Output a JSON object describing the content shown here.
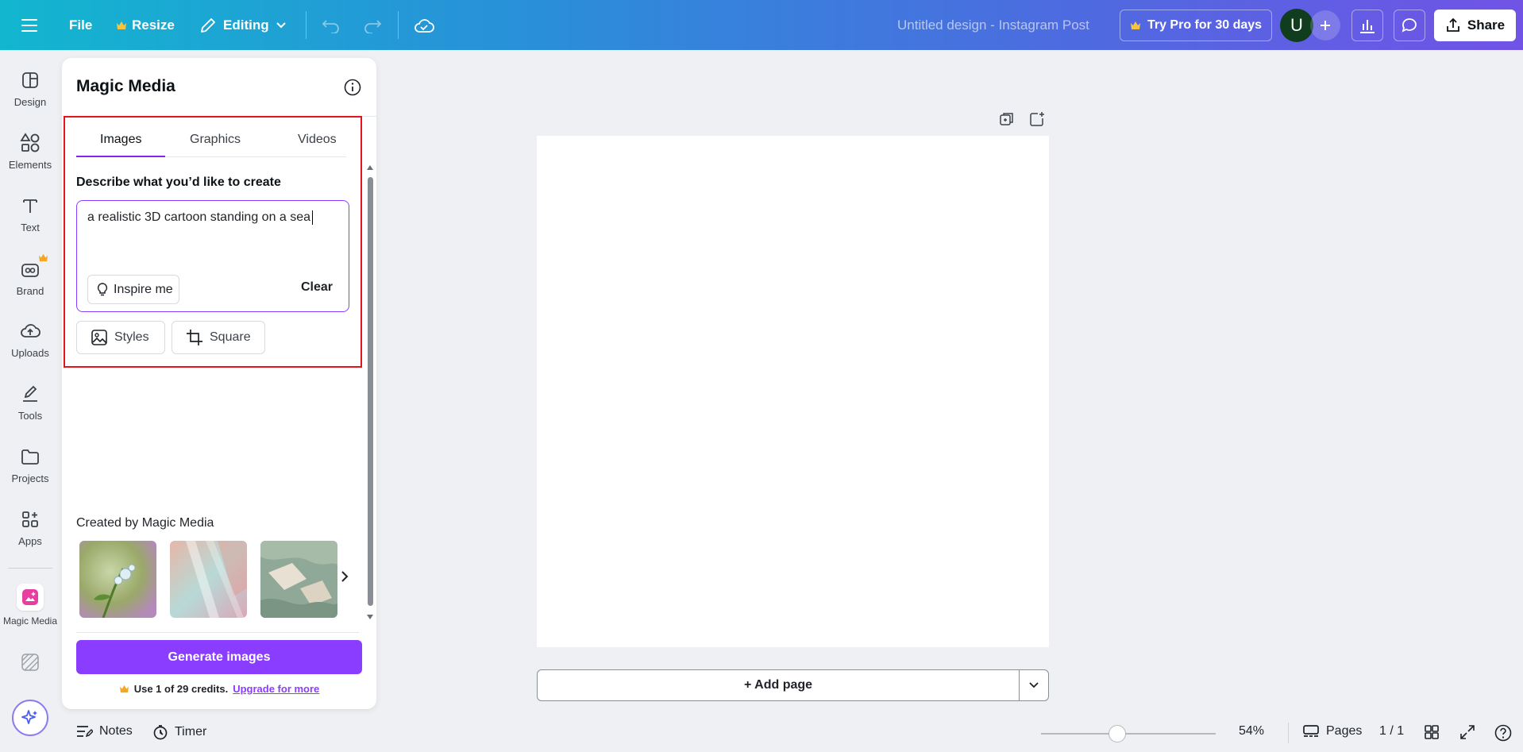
{
  "topbar": {
    "file_label": "File",
    "resize_label": "Resize",
    "editing_label": "Editing",
    "doc_title": "Untitled design - Instagram Post",
    "try_pro_label": "Try Pro for 30 days",
    "avatar_initial": "U",
    "share_label": "Share"
  },
  "rail": {
    "items": [
      {
        "label": "Design"
      },
      {
        "label": "Elements"
      },
      {
        "label": "Text"
      },
      {
        "label": "Brand"
      },
      {
        "label": "Uploads"
      },
      {
        "label": "Tools"
      },
      {
        "label": "Projects"
      },
      {
        "label": "Apps"
      },
      {
        "label": "Magic Media"
      }
    ]
  },
  "panel": {
    "title": "Magic Media",
    "tabs": [
      {
        "label": "Images",
        "active": true
      },
      {
        "label": "Graphics",
        "active": false
      },
      {
        "label": "Videos",
        "active": false
      }
    ],
    "describe_label": "Describe what you’d like to create",
    "prompt_value": "a realistic 3D cartoon standing on a sea",
    "inspire_label": "Inspire me",
    "clear_label": "Clear",
    "styles_label": "Styles",
    "aspect_label": "Square",
    "created_label": "Created by Magic Media",
    "generate_label": "Generate images",
    "credits_text": "Use 1 of 29 credits.",
    "credits_link": "Upgrade for more"
  },
  "canvas": {
    "add_page_label": "+ Add page"
  },
  "bottombar": {
    "notes_label": "Notes",
    "timer_label": "Timer",
    "zoom_label": "54%",
    "pages_label": "Pages",
    "page_count": "1 / 1"
  },
  "colors": {
    "accent": "#8b3dff",
    "highlight": "#e5141c",
    "crown": "#f5a623"
  }
}
